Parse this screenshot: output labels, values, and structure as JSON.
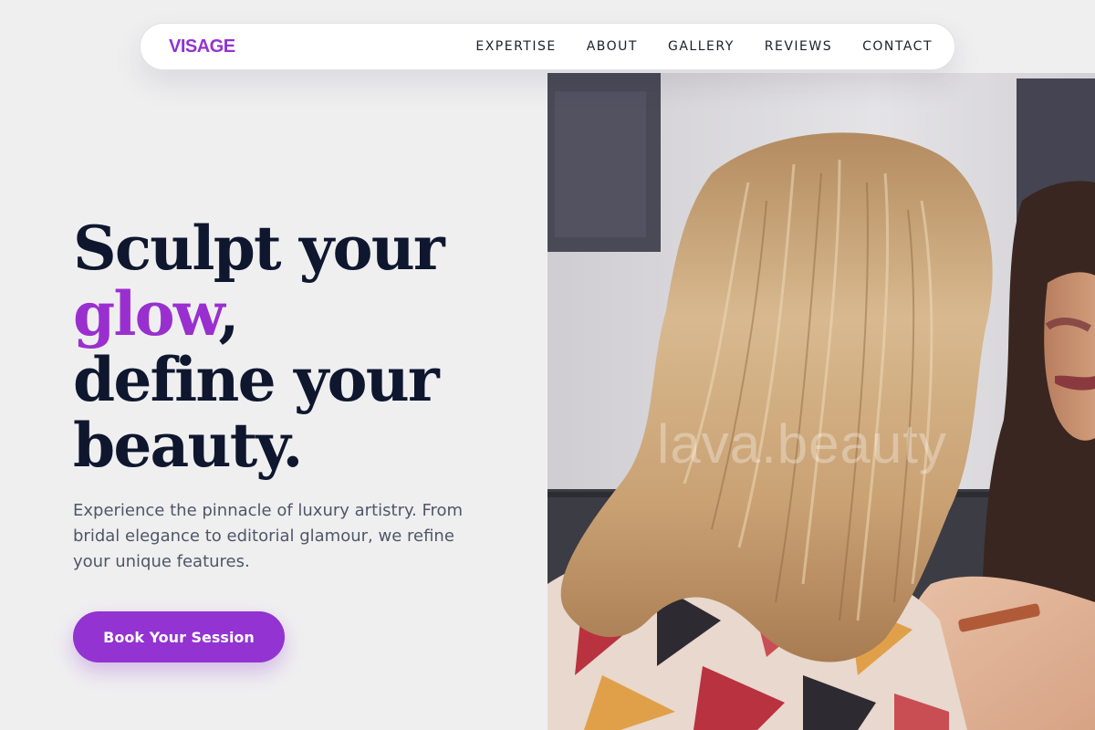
{
  "brand": {
    "logo": "VISAGE",
    "accent_color": "#9333d1"
  },
  "nav": {
    "items": [
      {
        "label": "EXPERTISE"
      },
      {
        "label": "ABOUT"
      },
      {
        "label": "GALLERY"
      },
      {
        "label": "REVIEWS"
      },
      {
        "label": "CONTACT"
      }
    ]
  },
  "hero": {
    "headline_line1": "Sculpt your",
    "headline_accent": "glow",
    "headline_comma": ",",
    "headline_line3": "define your",
    "headline_line4": "beauty.",
    "lead": "Experience the pinnacle of luxury artistry. From bridal elegance to editorial glamour, we refine your unique features.",
    "cta_label": "Book Your Session",
    "photo_watermark": "lava.beauty",
    "photo_icon": "makeup-artist-photo"
  }
}
